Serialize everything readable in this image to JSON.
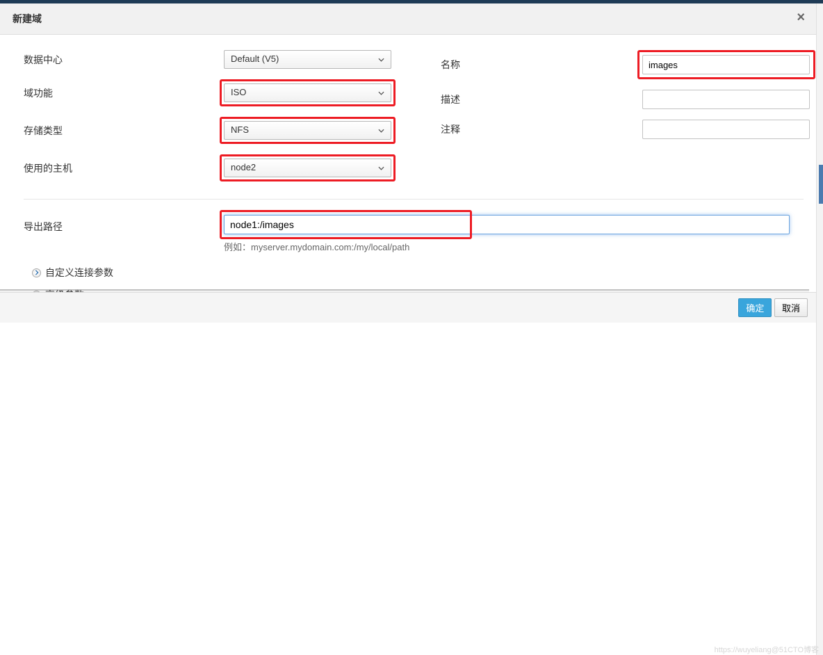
{
  "header": {
    "title": "新建域"
  },
  "labels": {
    "dataCenter": "数据中心",
    "domainFunction": "域功能",
    "storageType": "存储类型",
    "useHost": "使用的主机",
    "name": "名称",
    "description": "描述",
    "comment": "注释",
    "exportPath": "导出路径"
  },
  "values": {
    "dataCenter": "Default (V5)",
    "domainFunction": "ISO",
    "storageType": "NFS",
    "useHost": "node2",
    "name": "images",
    "description": "",
    "comment": "",
    "exportPath": "node1:/images"
  },
  "hint": "例如：myserver.mydomain.com:/my/local/path",
  "expand": {
    "customConn": "自定义连接参数",
    "advanced": "高级参数"
  },
  "footer": {
    "ok": "确定",
    "cancel": "取消"
  },
  "watermark": "https://wuyeliang@51CTO博客"
}
